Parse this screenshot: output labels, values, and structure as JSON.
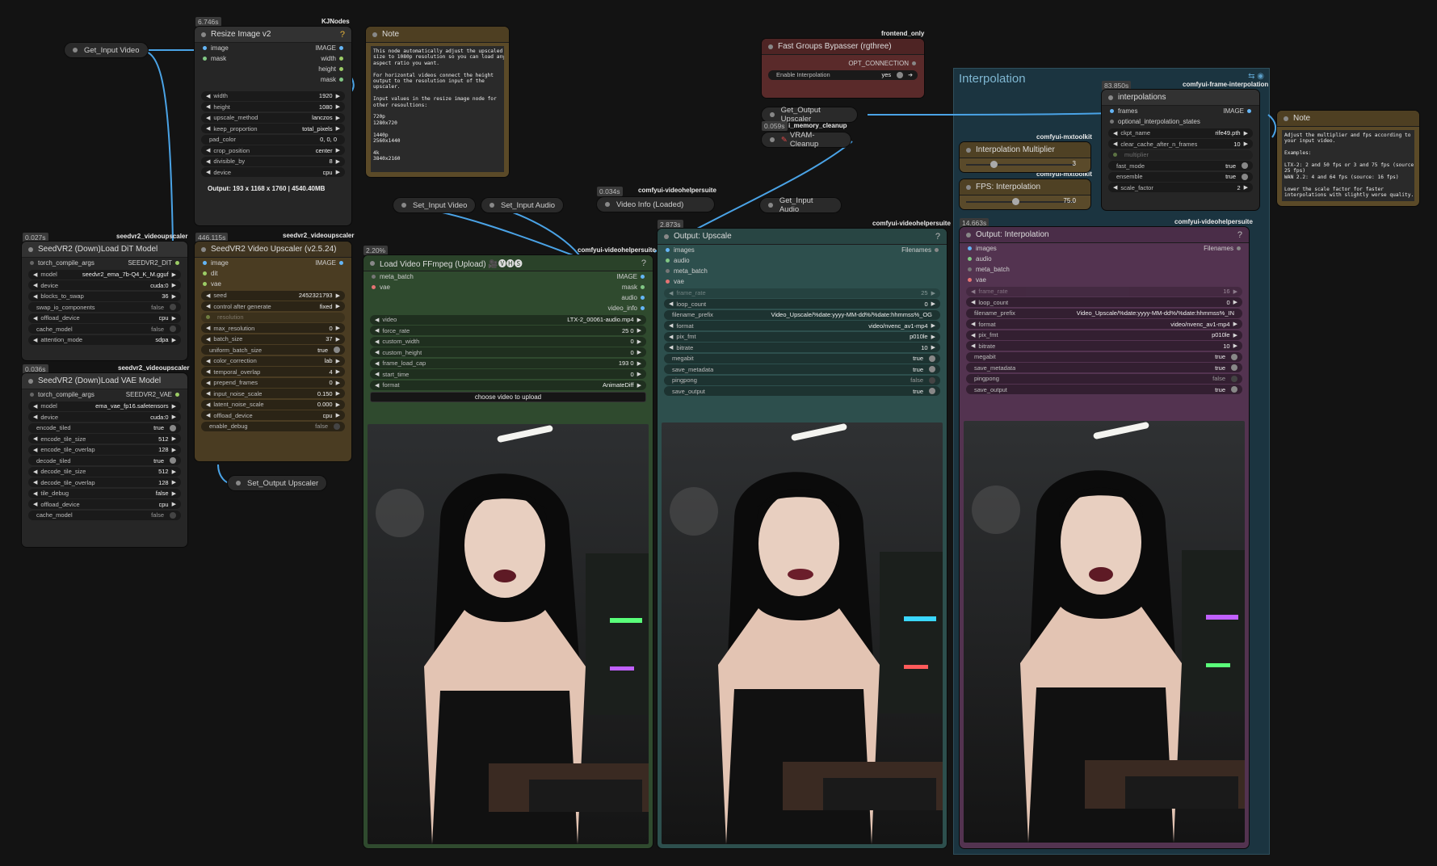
{
  "group": {
    "title": "Interpolation"
  },
  "colors": {
    "wire": "#4aa3e6",
    "green_group": "#2f4a2e",
    "teal": "#2d4f4d",
    "purple": "#533350",
    "brown": "#5a4a2a",
    "red": "#5a2a2a",
    "canvas": "#131313"
  },
  "pills": {
    "get_input_video": "Get_Input Video",
    "set_input_video": "Set_Input Video",
    "set_input_audio": "Set_Input Audio",
    "video_info": "Video Info (Loaded)",
    "get_input_audio": "Get_Input Audio",
    "set_output_upscaler": "Set_Output Upscaler",
    "get_output_upscaler": "Get_Output Upscaler",
    "vram_cleanup": "VRAM-Cleanup"
  },
  "badges": {
    "kjnodes": "KJNodes",
    "seedvr2_a": "seedvr2_videoupscaler",
    "seedvr2_b": "seedvr2_videoupscaler",
    "seedvr2_c": "seedvr2_videoupscaler",
    "vhs_a": "comfyui-videohelpersuite",
    "vhs_b": "comfyui-videohelpersuite",
    "vhs_c": "comfyui-videohelpersuite",
    "vhs_d": "comfyui-videohelpersuite",
    "frontend": "frontend_only",
    "memory": "i_memory_cleanup",
    "mxtoolkit_a": "comfyui-mxtoolkit",
    "mxtoolkit_b": "comfyui-mxtoolkit",
    "fi": "comfyui-frame-interpolation"
  },
  "timings": {
    "resize": "6.746s",
    "dit": "0.027s",
    "vae": "0.036s",
    "upscaler": "446.115s",
    "load": "2.20%",
    "vinfo": "0.034s",
    "out_up": "2.873s",
    "get_out": "0.059s",
    "out_int": "14.663s",
    "interp": "83.850s"
  },
  "resize": {
    "title": "Resize Image v2",
    "in": [
      "image",
      "mask"
    ],
    "out": [
      "IMAGE",
      "width",
      "height",
      "mask"
    ],
    "widgets": [
      [
        "width",
        "1920"
      ],
      [
        "height",
        "1080"
      ],
      [
        "upscale_method",
        "lanczos"
      ],
      [
        "keep_proportion",
        "total_pixels"
      ],
      [
        "pad_color",
        "0, 0, 0"
      ],
      [
        "crop_position",
        "center"
      ],
      [
        "divisible_by",
        "8"
      ],
      [
        "device",
        "cpu"
      ]
    ],
    "output": "Output: 193 x 1168 x 1760 | 4540.40MB"
  },
  "note1": {
    "title": "Note",
    "text": "This node automatically adjust the upscaled\nsize to 1080p resolution so you can load any\naspect ratio you want.\n\nFor horizontal videos connect the height\noutput to the resolution input of the\nupscaler.\n\nInput values in the resize image node for\nother resoultions:\n\n720p\n1280x720\n\n1440p\n2560x1440\n\n4k\n3840x2160"
  },
  "dit": {
    "title": "SeedVR2 (Down)Load DiT Model",
    "in": "torch_compile_args",
    "out": "SEEDVR2_DIT",
    "widgets": [
      [
        "model",
        "seedvr2_ema_7b-Q4_K_M.gguf"
      ],
      [
        "device",
        "cuda:0"
      ],
      [
        "blocks_to_swap",
        "36"
      ],
      [
        "swap_io_components",
        "false"
      ],
      [
        "offload_device",
        "cpu"
      ],
      [
        "cache_model",
        "false"
      ],
      [
        "attention_mode",
        "sdpa"
      ]
    ]
  },
  "vae": {
    "title": "SeedVR2 (Down)Load VAE Model",
    "in": "torch_compile_args",
    "out": "SEEDVR2_VAE",
    "widgets": [
      [
        "model",
        "ema_vae_fp16.safetensors"
      ],
      [
        "device",
        "cuda:0"
      ],
      [
        "encode_tiled",
        "true"
      ],
      [
        "encode_tile_size",
        "512"
      ],
      [
        "encode_tile_overlap",
        "128"
      ],
      [
        "decode_tiled",
        "true"
      ],
      [
        "decode_tile_size",
        "512"
      ],
      [
        "decode_tile_overlap",
        "128"
      ],
      [
        "tile_debug",
        "false"
      ],
      [
        "offload_device",
        "cpu"
      ],
      [
        "cache_model",
        "false"
      ]
    ]
  },
  "upscaler": {
    "title": "SeedVR2 Video Upscaler (v2.5.24)",
    "in": [
      "image",
      "dit",
      "vae"
    ],
    "out": "IMAGE",
    "widgets": [
      [
        "seed",
        "2452321793"
      ],
      [
        "control after generate",
        "fixed"
      ],
      [
        "resolution",
        ""
      ],
      [
        "max_resolution",
        "0"
      ],
      [
        "batch_size",
        "37"
      ],
      [
        "uniform_batch_size",
        "true"
      ],
      [
        "color_correction",
        "lab"
      ],
      [
        "temporal_overlap",
        "4"
      ],
      [
        "prepend_frames",
        "0"
      ],
      [
        "input_noise_scale",
        "0.150"
      ],
      [
        "latent_noise_scale",
        "0.000"
      ],
      [
        "offload_device",
        "cpu"
      ],
      [
        "enable_debug",
        "false"
      ]
    ]
  },
  "load": {
    "title": "Load Video FFmpeg (Upload) 🎥🅥🅗🅢",
    "in": [
      "meta_batch",
      "vae"
    ],
    "out": [
      "IMAGE",
      "mask",
      "audio",
      "video_info"
    ],
    "widgets": [
      [
        "video",
        "LTX-2_00061-audio.mp4"
      ],
      [
        "force_rate",
        "25 0"
      ],
      [
        "custom_width",
        "0"
      ],
      [
        "custom_height",
        "0"
      ],
      [
        "frame_load_cap",
        "193 0"
      ],
      [
        "start_time",
        "0"
      ],
      [
        "format",
        "AnimateDiff"
      ]
    ],
    "button": "choose video to upload"
  },
  "bypasser": {
    "title": "Fast Groups Bypasser (rgthree)",
    "out": "OPT_CONNECTION",
    "widget": [
      "Enable Interpolation",
      "yes"
    ]
  },
  "out_up": {
    "title": "Output: Upscale",
    "in": [
      "images",
      "audio",
      "meta_batch",
      "vae"
    ],
    "out": "Filenames",
    "widgets": [
      [
        "frame_rate",
        "25"
      ],
      [
        "loop_count",
        "0"
      ],
      [
        "filename_prefix",
        "Video_Upscale/%date:yyyy-MM-dd%/%date:hhmmss%_OG"
      ],
      [
        "format",
        "video/nvenc_av1-mp4"
      ],
      [
        "pix_fmt",
        "p010le"
      ],
      [
        "bitrate",
        "10"
      ],
      [
        "megabit",
        "true"
      ],
      [
        "save_metadata",
        "true"
      ],
      [
        "pingpong",
        "false"
      ],
      [
        "save_output",
        "true"
      ]
    ]
  },
  "out_int": {
    "title": "Output: Interpolation",
    "in": [
      "images",
      "audio",
      "meta_batch",
      "vae"
    ],
    "out": "Filenames",
    "widgets": [
      [
        "frame_rate",
        "16"
      ],
      [
        "loop_count",
        "0"
      ],
      [
        "filename_prefix",
        "Video_Upscale/%date:yyyy-MM-dd%/%date:hhmmss%_IN"
      ],
      [
        "format",
        "video/nvenc_av1-mp4"
      ],
      [
        "pix_fmt",
        "p010le"
      ],
      [
        "bitrate",
        "10"
      ],
      [
        "megabit",
        "true"
      ],
      [
        "save_metadata",
        "true"
      ],
      [
        "pingpong",
        "false"
      ],
      [
        "save_output",
        "true"
      ]
    ]
  },
  "interp": {
    "title": "interpolations",
    "in": [
      "frames",
      "optional_interpolation_states"
    ],
    "out": "IMAGE",
    "widgets": [
      [
        "ckpt_name",
        "rife49.pth"
      ],
      [
        "clear_cache_after_n_frames",
        "10"
      ],
      [
        "multiplier",
        ""
      ],
      [
        "fast_mode",
        "true"
      ],
      [
        "ensemble",
        "true"
      ],
      [
        "scale_factor",
        "2"
      ]
    ]
  },
  "mult": {
    "title": "Interpolation Multiplier",
    "value": "3"
  },
  "fps": {
    "title": "FPS: Interpolation",
    "value": "75.0"
  },
  "note2": {
    "title": "Note",
    "text": "Adjust the multiplier and fps according to\nyour input video.\n\nExamples:\n\nLTX-2: 2 and 50 fps or 3 and 75 fps (source:\n25 fps)\nWAN 2.2: 4 and 64 fps (source: 16 fps)\n\nLower the scale factor for faster\ninterpolations with slightly worse quality."
  }
}
